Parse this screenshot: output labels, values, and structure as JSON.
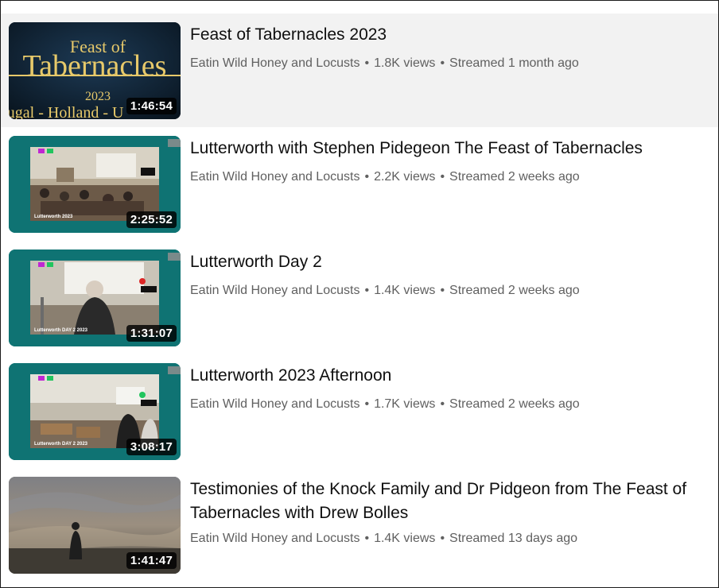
{
  "videos": [
    {
      "title": "Feast of Tabernacles 2023",
      "channel": "Eatin Wild Honey and Locusts",
      "views": "1.8K views",
      "streamed": "Streamed 1 month ago",
      "duration": "1:46:54",
      "thumb": {
        "line1": "Feast of",
        "line2": "Tabernacles",
        "line3": "2023",
        "line4": "ortugal - Holland - U"
      }
    },
    {
      "title": "Lutterworth with Stephen Pidegeon The Feast of Tabernacles",
      "channel": "Eatin Wild Honey and Locusts",
      "views": "2.2K views",
      "streamed": "Streamed 2 weeks ago",
      "duration": "2:25:52",
      "thumb": {
        "caption": "Lutterworth 2023"
      }
    },
    {
      "title": "Lutterworth Day 2",
      "channel": "Eatin Wild Honey and Locusts",
      "views": "1.4K views",
      "streamed": "Streamed 2 weeks ago",
      "duration": "1:31:07",
      "thumb": {
        "caption": "Lutterworth DAY 2 2023"
      }
    },
    {
      "title": "Lutterworth 2023 Afternoon",
      "channel": "Eatin Wild Honey and Locusts",
      "views": "1.7K views",
      "streamed": "Streamed 2 weeks ago",
      "duration": "3:08:17",
      "thumb": {
        "caption": "Lutterworth DAY 2 2023"
      }
    },
    {
      "title": "Testimonies of the Knock Family and Dr Pidgeon from The Feast of Tabernacles with Drew Bolles",
      "channel": "Eatin Wild Honey and Locusts",
      "views": "1.4K views",
      "streamed": "Streamed 13 days ago",
      "duration": "1:41:47"
    }
  ],
  "meta_separator": "•",
  "colors": {
    "thumb_teal": "#0f7373",
    "hover_bg": "#f2f2f2",
    "meta_text": "#606060",
    "gold": "#e7c96a"
  }
}
